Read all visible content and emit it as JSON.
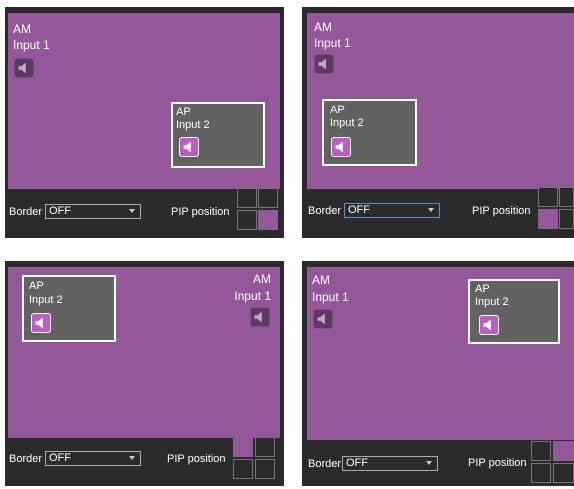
{
  "panels": [
    {
      "main_source": {
        "name": "AM",
        "input": "Input 1"
      },
      "pip_source": {
        "name": "AP",
        "input": "Input 2"
      },
      "border": {
        "label": "Border",
        "value": "OFF"
      },
      "pip_position": {
        "label": "PIP position",
        "selected": "bottom-right"
      }
    },
    {
      "main_source": {
        "name": "AM",
        "input": "Input 1"
      },
      "pip_source": {
        "name": "AP",
        "input": "Input 2"
      },
      "border": {
        "label": "Border",
        "value": "OFF"
      },
      "pip_position": {
        "label": "PIP position",
        "selected": "bottom-left"
      }
    },
    {
      "main_source": {
        "name": "AM",
        "input": "Input 1"
      },
      "pip_source": {
        "name": "AP",
        "input": "Input 2"
      },
      "border": {
        "label": "Border",
        "value": "OFF"
      },
      "pip_position": {
        "label": "PIP position",
        "selected": "top-left"
      }
    },
    {
      "main_source": {
        "name": "AM",
        "input": "Input 1"
      },
      "pip_source": {
        "name": "AP",
        "input": "Input 2"
      },
      "border": {
        "label": "Border",
        "value": "OFF"
      },
      "pip_position": {
        "label": "PIP position",
        "selected": "top-right"
      }
    }
  ],
  "colors": {
    "video_bg": "#94589a",
    "pip_bg": "#626262",
    "panel_bg": "#2b2b2b",
    "speaker_active": "#b95fc0"
  },
  "icons": {
    "speaker": "speaker-icon"
  }
}
